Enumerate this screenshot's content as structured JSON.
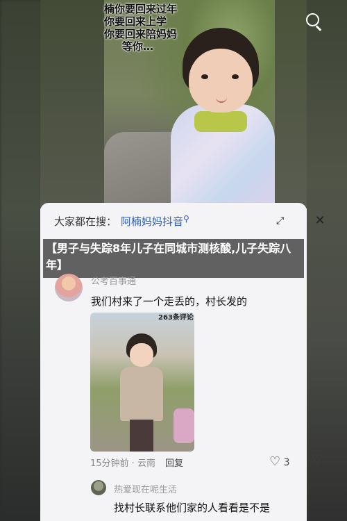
{
  "video": {
    "caption_lines": [
      "楠你要回来过年",
      "你要回来上学",
      "你要回来陪妈妈",
      "等你…"
    ]
  },
  "search_panel": {
    "prefix": "大家都在搜：",
    "query": "阿楠妈妈抖音"
  },
  "headline": "【男子与失踪8年儿子在同城市测核酸,儿子失踪八年】",
  "comments": [
    {
      "username": "公考百事通",
      "text": "我们村来了一个走丢的，村长发的",
      "photo_overlay": "263条评论",
      "time": "15分钟前",
      "location": "云南",
      "reply_label": "回复",
      "likes": "3"
    },
    {
      "username": "热爱现在呢生活",
      "text": "找村长联系他们家的人看看是不是"
    }
  ],
  "icons": {
    "search": "search-icon",
    "expand": "expand-icon",
    "close": "close-icon",
    "like": "heart-icon",
    "dislike": "broken-heart-icon"
  },
  "colors": {
    "query": "#2d5fb3",
    "headline_bg": "#282828"
  }
}
